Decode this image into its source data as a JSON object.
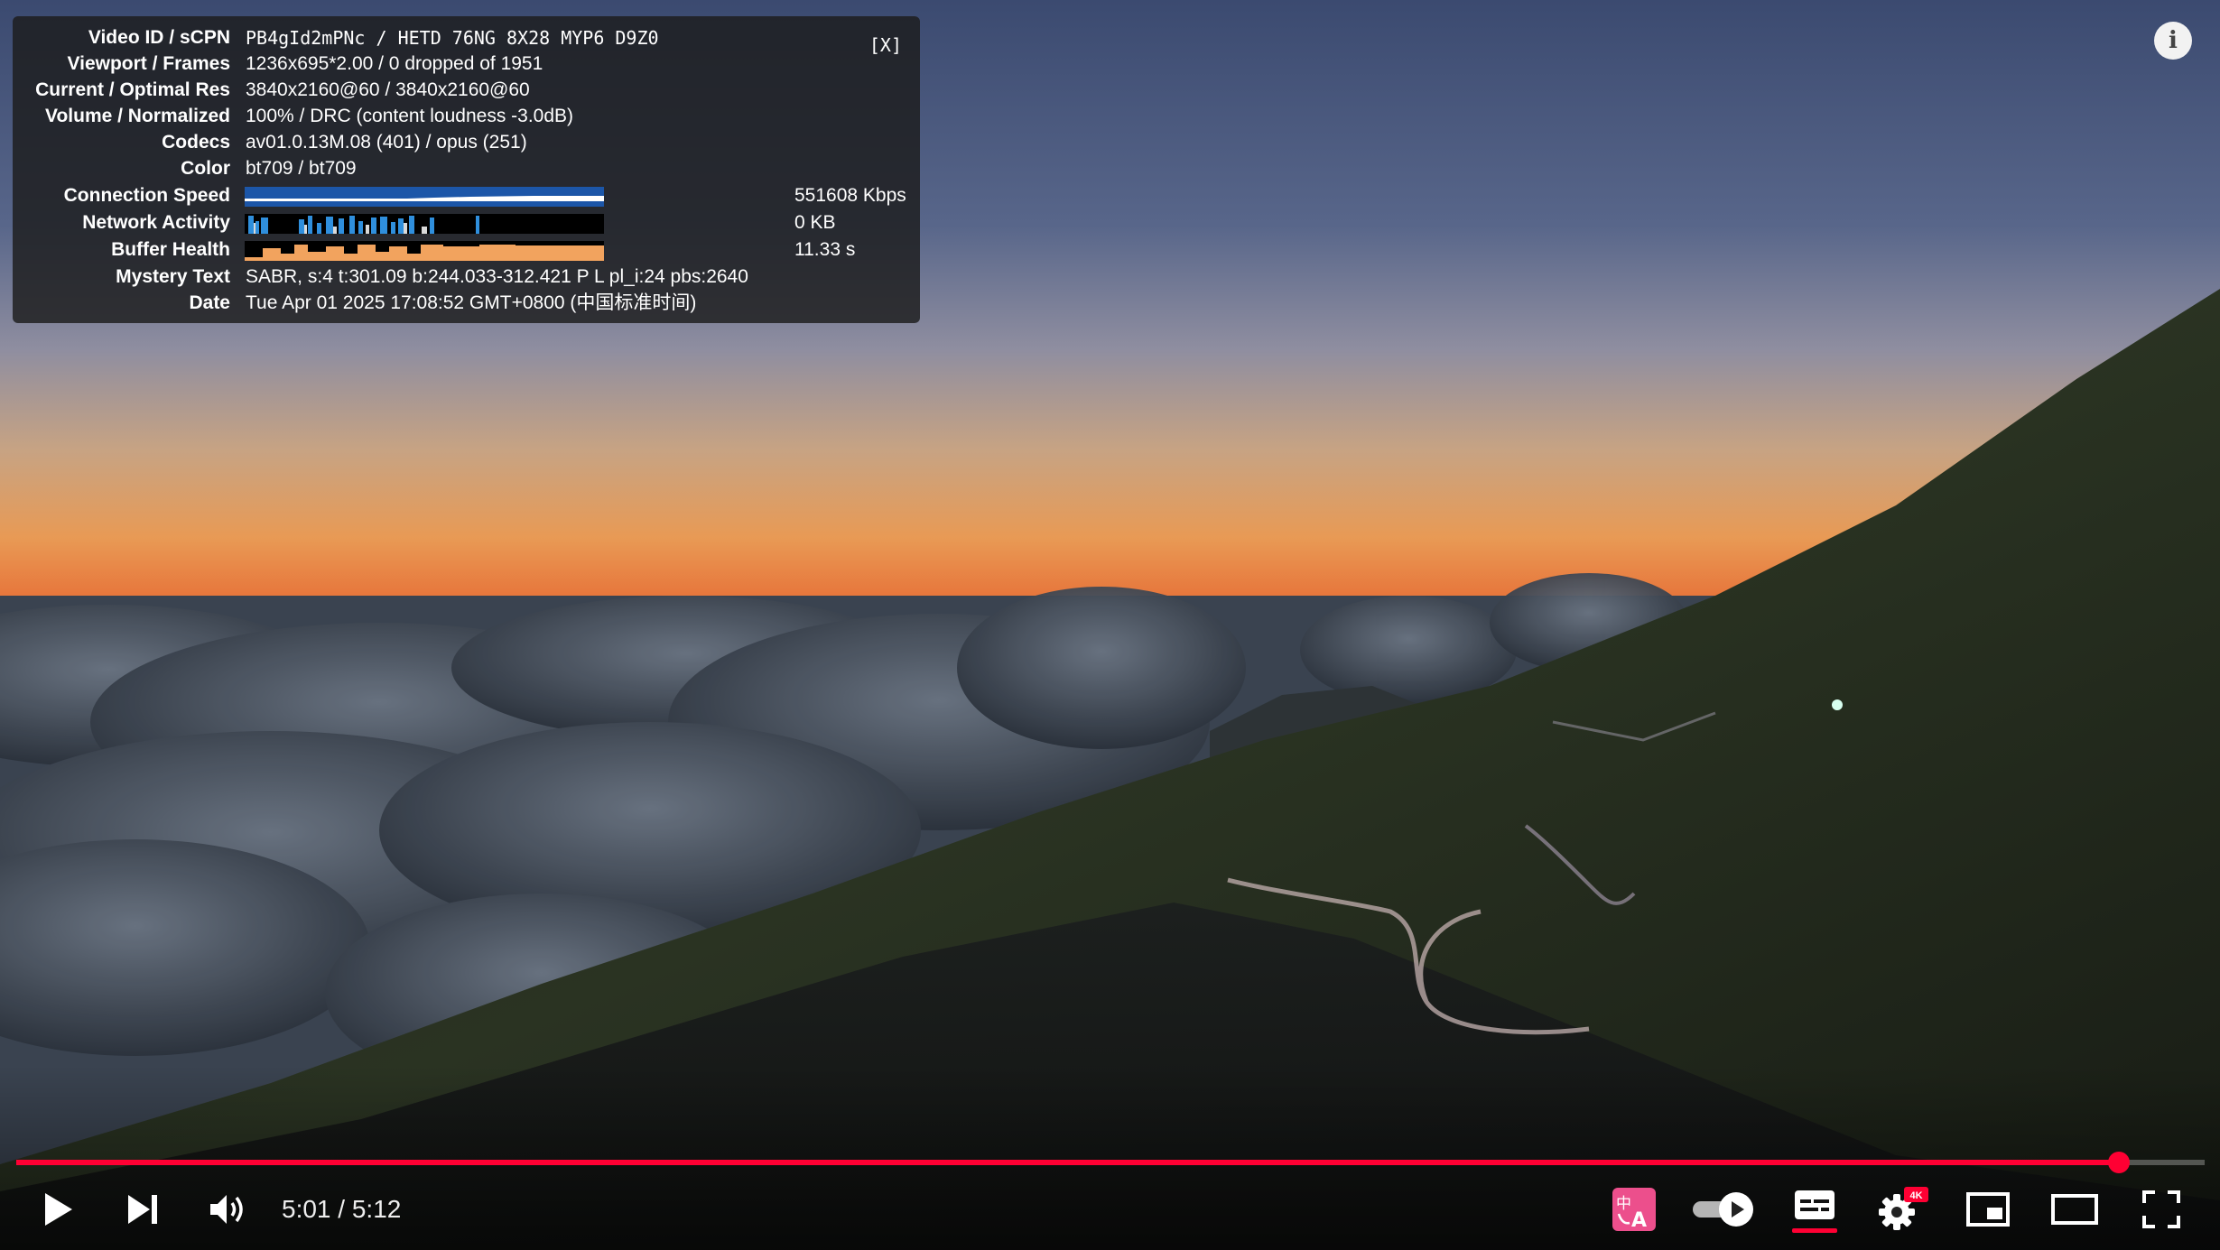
{
  "stats_panel": {
    "close_label": "[X]",
    "rows": [
      {
        "label": "Video ID / sCPN",
        "value": "PB4gId2mPNc / HETD 76NG 8X28 MYP6 D9Z0"
      },
      {
        "label": "Viewport / Frames",
        "value": "1236x695*2.00 / 0 dropped of 1951"
      },
      {
        "label": "Current / Optimal Res",
        "value": "3840x2160@60 / 3840x2160@60"
      },
      {
        "label": "Volume / Normalized",
        "value": "100% / DRC (content loudness -3.0dB)"
      },
      {
        "label": "Codecs",
        "value": "av01.0.13M.08 (401) / opus (251)"
      },
      {
        "label": "Color",
        "value": "bt709 / bt709"
      },
      {
        "label": "Connection Speed",
        "value": "551608 Kbps"
      },
      {
        "label": "Network Activity",
        "value": "0 KB"
      },
      {
        "label": "Buffer Health",
        "value": "11.33 s"
      },
      {
        "label": "Mystery Text",
        "value": "SABR, s:4 t:301.09 b:244.033-312.421 P L pl_i:24 pbs:2640"
      },
      {
        "label": "Date",
        "value": "Tue Apr 01 2025 17:08:52 GMT+0800 (中国标准时间)"
      }
    ],
    "colors": {
      "connection": "#1c56a8",
      "network": "#2f8fdd",
      "buffer": "#f2a35e"
    }
  },
  "player": {
    "time_current": "5:01",
    "time_separator": " / ",
    "time_total": "5:12",
    "progress_fraction": 0.961,
    "quality_badge": "4K",
    "accent_color": "#ff0033",
    "icons": [
      "play-icon",
      "next-icon",
      "volume-icon",
      "translate-icon",
      "autoplay-toggle-icon",
      "subtitles-icon",
      "settings-icon",
      "miniplayer-icon",
      "theater-icon",
      "fullscreen-icon",
      "info-icon"
    ]
  }
}
